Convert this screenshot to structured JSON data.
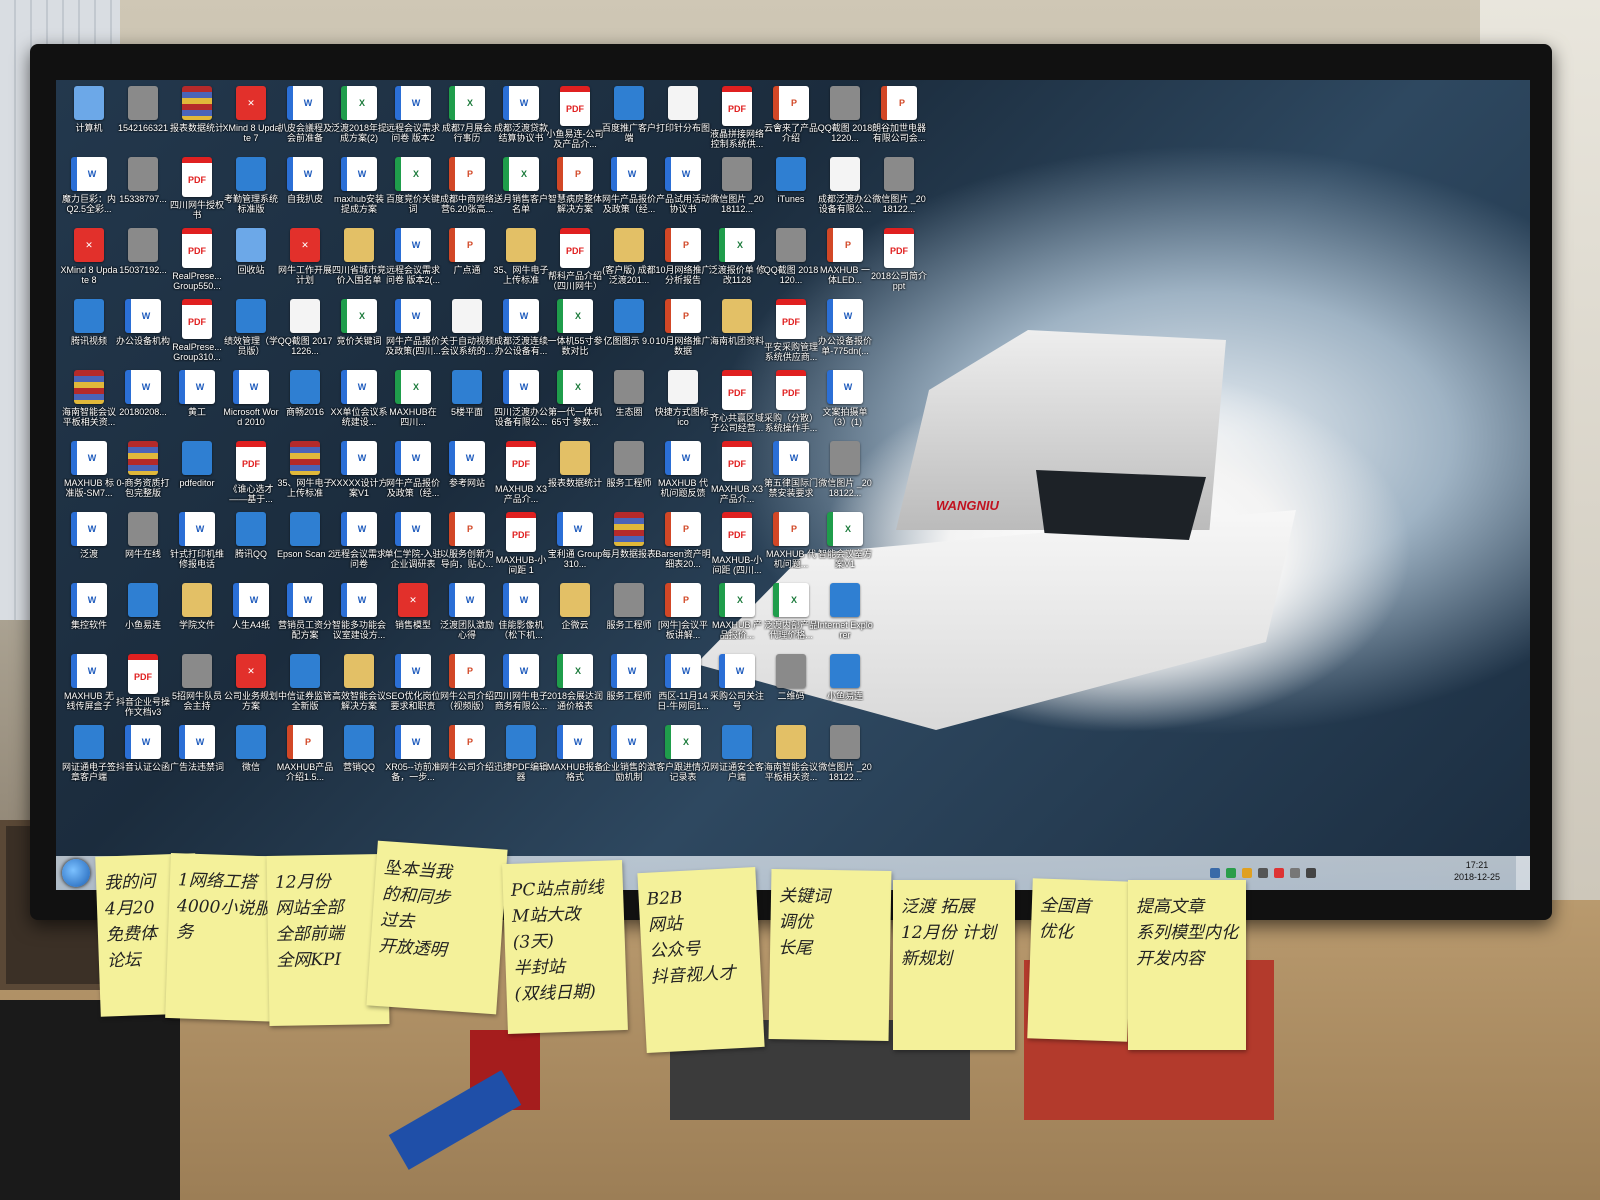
{
  "desktop": {
    "icons": [
      {
        "label": "计算机",
        "type": "sys"
      },
      {
        "label": "1542166321",
        "type": "img"
      },
      {
        "label": "报表数据统计",
        "type": "rar"
      },
      {
        "label": "XMind 8 Update 7",
        "type": "xmind"
      },
      {
        "label": "扒皮会議程及会前准备",
        "type": "word"
      },
      {
        "label": "泛渡2018年提成方案(2)",
        "type": "excel"
      },
      {
        "label": "远程会议需求问卷 版本2",
        "type": "word"
      },
      {
        "label": "成都7月展会行事历",
        "type": "excel"
      },
      {
        "label": "成都泛渡贷款结算协议书",
        "type": "word"
      },
      {
        "label": "小鱼易连-公司及产品介...",
        "type": "pdf"
      },
      {
        "label": "百度推广客户端",
        "type": "app"
      },
      {
        "label": "打印针分布图",
        "type": "blank"
      },
      {
        "label": "液晶拼接网络控制系统供...",
        "type": "pdf"
      },
      {
        "label": "云會来了产品介绍",
        "type": "ppt"
      },
      {
        "label": "QQ截图 20181220...",
        "type": "img"
      },
      {
        "label": "朗谷加世电器有限公司会...",
        "type": "ppt"
      },
      {
        "label": "魔力巨彩：内Q2.5全彩...",
        "type": "word"
      },
      {
        "label": "15338797...",
        "type": "img"
      },
      {
        "label": "四川网牛授权书",
        "type": "pdf"
      },
      {
        "label": "考勤管理系统 标准版",
        "type": "app"
      },
      {
        "label": "自我扒皮",
        "type": "word"
      },
      {
        "label": "maxhub安装提成方案",
        "type": "word"
      },
      {
        "label": "百度竞价关键词",
        "type": "excel"
      },
      {
        "label": "成都中商网络营6.20张高...",
        "type": "ppt"
      },
      {
        "label": "送月销售客户名单",
        "type": "excel"
      },
      {
        "label": "智慧病房整体解决方案",
        "type": "ppt"
      },
      {
        "label": "网牛产品报价及政策（经...",
        "type": "word"
      },
      {
        "label": "产品试用活动协议书",
        "type": "word"
      },
      {
        "label": "微信图片 _2018112...",
        "type": "img"
      },
      {
        "label": "iTunes",
        "type": "app"
      },
      {
        "label": "成都泛渡办公设备有限公...",
        "type": "blank"
      },
      {
        "label": "微信图片 _2018122...",
        "type": "img"
      },
      {
        "label": "XMind 8 Update 8",
        "type": "xmind"
      },
      {
        "label": "15037192...",
        "type": "img"
      },
      {
        "label": "RealPrese... Group550...",
        "type": "pdf"
      },
      {
        "label": "回收站",
        "type": "sys"
      },
      {
        "label": "网牛工作开展计划",
        "type": "xmind"
      },
      {
        "label": "四川省城市竞价入围名单",
        "type": "folder"
      },
      {
        "label": "远程会议需求问卷 版本2(...",
        "type": "word"
      },
      {
        "label": "广点通",
        "type": "ppt"
      },
      {
        "label": "35、网牛电子上传标准",
        "type": "folder"
      },
      {
        "label": "帮科产品介绍（四川网牛）",
        "type": "pdf"
      },
      {
        "label": "(客户版) 成都泛渡201...",
        "type": "folder"
      },
      {
        "label": "10月网络推广分析报告",
        "type": "ppt"
      },
      {
        "label": "泛渡报价单 修改1128",
        "type": "excel"
      },
      {
        "label": "QQ截图 2018120...",
        "type": "img"
      },
      {
        "label": "MAXHUB 一体LED...",
        "type": "ppt"
      },
      {
        "label": "2018公司简介ppt",
        "type": "pdf"
      },
      {
        "label": "腾讯视频",
        "type": "app"
      },
      {
        "label": "办公设备机构",
        "type": "word"
      },
      {
        "label": "RealPrese... Group310...",
        "type": "pdf"
      },
      {
        "label": "绩效管理（学员版）",
        "type": "app"
      },
      {
        "label": "QQ截图 20171226...",
        "type": "blank"
      },
      {
        "label": "竞价关键词",
        "type": "excel"
      },
      {
        "label": "网牛产品报价及政策(四川...",
        "type": "word"
      },
      {
        "label": "关于自动视频会议系统的...",
        "type": "blank"
      },
      {
        "label": "成都泛渡连续办公设备有...",
        "type": "word"
      },
      {
        "label": "一体机55寸参数对比",
        "type": "excel"
      },
      {
        "label": "亿图图示 9.0",
        "type": "app"
      },
      {
        "label": "10月网络推广数据",
        "type": "ppt"
      },
      {
        "label": "海南机团资料",
        "type": "folder"
      },
      {
        "label": "平安采购管理系统供应商...",
        "type": "pdf"
      },
      {
        "label": "办公设备报价单-775dn(...",
        "type": "word"
      },
      {
        "label": "海南智能会议平板相关资...",
        "type": "rar"
      },
      {
        "label": "20180208...",
        "type": "word"
      },
      {
        "label": "黄工",
        "type": "word"
      },
      {
        "label": "Microsoft Word 2010",
        "type": "word"
      },
      {
        "label": "商畅2016",
        "type": "app"
      },
      {
        "label": "XX单位会议系统建设...",
        "type": "word"
      },
      {
        "label": "MAXHUB在 四川...",
        "type": "excel"
      },
      {
        "label": "5楼平面",
        "type": "app"
      },
      {
        "label": "四川泛渡办公设备有限公...",
        "type": "word"
      },
      {
        "label": "第一代一体机 65寸 参数...",
        "type": "excel"
      },
      {
        "label": "生态圈",
        "type": "img"
      },
      {
        "label": "快捷方式图标.ico",
        "type": "blank"
      },
      {
        "label": "齐心共赢区域子公司经营...",
        "type": "pdf"
      },
      {
        "label": "采购（分散）系统操作手...",
        "type": "pdf"
      },
      {
        "label": "文案拍摄单（3）(1)",
        "type": "word"
      },
      {
        "label": "MAXHUB 标准版-SM7...",
        "type": "word"
      },
      {
        "label": "0-商务资质打包完整版",
        "type": "rar"
      },
      {
        "label": "pdfeditor",
        "type": "app"
      },
      {
        "label": "《谁心选才——基于...",
        "type": "pdf"
      },
      {
        "label": "35、网牛电子上传标准",
        "type": "rar"
      },
      {
        "label": "XXXXX设计方案V1",
        "type": "word"
      },
      {
        "label": "网牛产品报价及政策（经...",
        "type": "word"
      },
      {
        "label": "参考网站",
        "type": "word"
      },
      {
        "label": "MAXHUB X3 产品介...",
        "type": "pdf"
      },
      {
        "label": "报表数据统计",
        "type": "folder"
      },
      {
        "label": "服务工程师",
        "type": "img"
      },
      {
        "label": "MAXHUB 代机问题反馈",
        "type": "word"
      },
      {
        "label": "MAXHUB X3 产品介...",
        "type": "pdf"
      },
      {
        "label": "第五律国际门禁安装要求",
        "type": "word"
      },
      {
        "label": "微信图片 _2018122...",
        "type": "img"
      },
      {
        "label": "泛渡",
        "type": "word"
      },
      {
        "label": "网牛在线",
        "type": "img"
      },
      {
        "label": "针式打印机维修报电话",
        "type": "word"
      },
      {
        "label": "腾讯QQ",
        "type": "app"
      },
      {
        "label": "Epson Scan 2",
        "type": "app"
      },
      {
        "label": "远程会议需求问卷",
        "type": "word"
      },
      {
        "label": "单仁学院-入驻企业调研表",
        "type": "word"
      },
      {
        "label": "以服务创新为导向，贴心...",
        "type": "ppt"
      },
      {
        "label": "MAXHUB-小间距 1",
        "type": "pdf"
      },
      {
        "label": "宝利通 Group310...",
        "type": "word"
      },
      {
        "label": "每月数据报表",
        "type": "rar"
      },
      {
        "label": "Barsen资产明细表20...",
        "type": "ppt"
      },
      {
        "label": "MAXHUB-小间距 (四川...",
        "type": "pdf"
      },
      {
        "label": "MAXHUB 代机问题...",
        "type": "ppt"
      },
      {
        "label": "智能会议室方案V1",
        "type": "excel"
      },
      {
        "label": "集控软件",
        "type": "word"
      },
      {
        "label": "小鱼易连",
        "type": "app"
      },
      {
        "label": "学院文件",
        "type": "folder"
      },
      {
        "label": "人生A4纸",
        "type": "word"
      },
      {
        "label": "营销员工资分配方案",
        "type": "word"
      },
      {
        "label": "智能多功能会议室建设方...",
        "type": "word"
      },
      {
        "label": "销售模型",
        "type": "xmind"
      },
      {
        "label": "泛渡团队激励心得",
        "type": "word"
      },
      {
        "label": "佳能影像机（松下机...",
        "type": "word"
      },
      {
        "label": "企微云",
        "type": "folder"
      },
      {
        "label": "服务工程师",
        "type": "img"
      },
      {
        "label": "[网牛]会议平板讲解...",
        "type": "ppt"
      },
      {
        "label": "MAXHUB 产品报价...",
        "type": "excel"
      },
      {
        "label": "泛渡内部产品代理价格...",
        "type": "excel"
      },
      {
        "label": "Internet Explorer",
        "type": "app"
      },
      {
        "label": "MAXHUB 无线传屏盒子",
        "type": "word"
      },
      {
        "label": "抖音企业号操作文档v3",
        "type": "pdf"
      },
      {
        "label": "5招网牛队员会主持",
        "type": "img"
      },
      {
        "label": "公司业务规划方案",
        "type": "xmind"
      },
      {
        "label": "中信证券监管全新版",
        "type": "app"
      },
      {
        "label": "高效智能会议解决方案",
        "type": "folder"
      },
      {
        "label": "SEO优化岗位要求和职责",
        "type": "word"
      },
      {
        "label": "网牛公司介绍（视频版）",
        "type": "ppt"
      },
      {
        "label": "四川网牛电子商务有限公...",
        "type": "word"
      },
      {
        "label": "2018会展达润通价格表",
        "type": "excel"
      },
      {
        "label": "服务工程师",
        "type": "word"
      },
      {
        "label": "西区-11月14日-牛网同1...",
        "type": "word"
      },
      {
        "label": "采购公司关注号",
        "type": "word"
      },
      {
        "label": "二维码",
        "type": "img"
      },
      {
        "label": "小鱼易连",
        "type": "app"
      },
      {
        "label": "网证通电子签章客户端",
        "type": "app"
      },
      {
        "label": "抖音认证公函",
        "type": "word"
      },
      {
        "label": "广告法违禁词",
        "type": "word"
      },
      {
        "label": "微信",
        "type": "app"
      },
      {
        "label": "MAXHUB产品介绍1.5...",
        "type": "ppt"
      },
      {
        "label": "营销QQ",
        "type": "app"
      },
      {
        "label": "XR05--访前准备，一步...",
        "type": "word"
      },
      {
        "label": "网牛公司介绍",
        "type": "ppt"
      },
      {
        "label": "迅捷PDF编辑器",
        "type": "app"
      },
      {
        "label": "MAXHUB报备格式",
        "type": "word"
      },
      {
        "label": "企业销售的激励机制",
        "type": "word"
      },
      {
        "label": "客户跟进情况记录表",
        "type": "excel"
      },
      {
        "label": "网证通安全客户端",
        "type": "app"
      },
      {
        "label": "海南智能会议平板相关资...",
        "type": "folder"
      },
      {
        "label": "微信图片 _2018122...",
        "type": "img"
      }
    ]
  },
  "taskbar": {
    "buttons": [
      {
        "name": "explorer-button",
        "glyph": "▤"
      },
      {
        "name": "ie-button",
        "glyph": "e"
      },
      {
        "name": "360-browser-button",
        "glyph": "◉"
      },
      {
        "name": "qq-browser-button",
        "glyph": "◎"
      },
      {
        "name": "edge-button",
        "glyph": "◐"
      },
      {
        "name": "media-button",
        "glyph": "▶"
      },
      {
        "name": "wechat-button",
        "glyph": "✉"
      },
      {
        "name": "app-button",
        "glyph": "✦"
      }
    ],
    "time": "17:21",
    "date": "2018-12-25"
  },
  "yacht_brand": "WANGNIU",
  "notes": [
    {
      "text": "我的问\n4月20\n免费体\n论坛"
    },
    {
      "text": "1网络工搭\n4000小说服务"
    },
    {
      "text": "12月份\n网站全部\n全部前端\n全网KPI"
    },
    {
      "text": "坠本当我\n的和同步\n过去\n开放透明"
    },
    {
      "text": "PC站点前线\nM站大改\n(3天)\n半封站\n(双线日期)"
    },
    {
      "text": "B2B\n网站\n公众号\n  抖音视人才"
    },
    {
      "text": "关键词\n调优\n   长尾"
    },
    {
      "text": "泛渡 拓展\n12月份 计划\n新规划"
    },
    {
      "text": "全国首\n优化"
    },
    {
      "text": "提高文章\n系列模型内化\n开发内容"
    }
  ]
}
